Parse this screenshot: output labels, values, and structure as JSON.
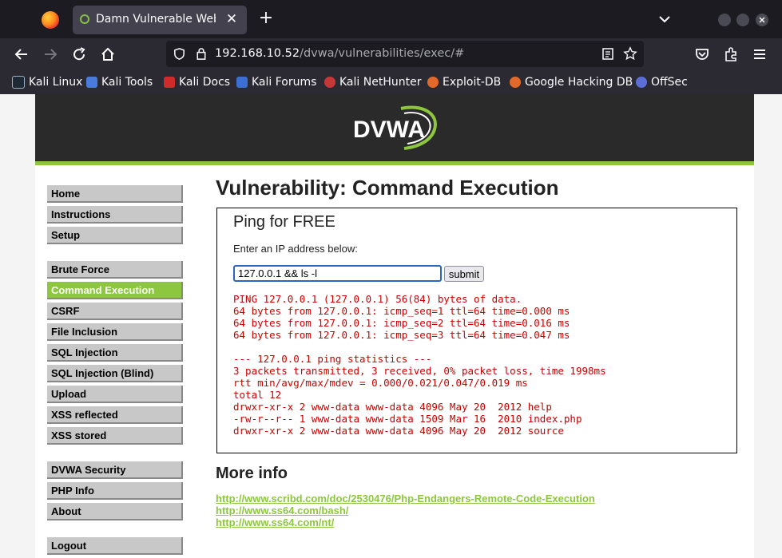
{
  "browser": {
    "tab_title": "Damn Vulnerable Web Ap",
    "url_host": "192.168.10.52",
    "url_path": "/dvwa/vulnerabilities/exec/#",
    "bookmarks": [
      {
        "label": "Kali Linux",
        "icon": "kali-icon"
      },
      {
        "label": "Kali Tools",
        "icon": "kali-tools-icon"
      },
      {
        "label": "Kali Docs",
        "icon": "kali-docs-icon"
      },
      {
        "label": "Kali Forums",
        "icon": "kali-forums-icon"
      },
      {
        "label": "Kali NetHunter",
        "icon": "nethunter-icon"
      },
      {
        "label": "Exploit-DB",
        "icon": "exploit-db-icon"
      },
      {
        "label": "Google Hacking DB",
        "icon": "ghdb-icon"
      },
      {
        "label": "OffSec",
        "icon": "offsec-icon"
      }
    ]
  },
  "header": {
    "logo_text": "DVWA"
  },
  "menu": {
    "items": [
      {
        "label": "Home"
      },
      {
        "label": "Instructions"
      },
      {
        "label": "Setup"
      },
      {
        "label": "Brute Force"
      },
      {
        "label": "Command Execution",
        "active": true
      },
      {
        "label": "CSRF"
      },
      {
        "label": "File Inclusion"
      },
      {
        "label": "SQL Injection"
      },
      {
        "label": "SQL Injection (Blind)"
      },
      {
        "label": "Upload"
      },
      {
        "label": "XSS reflected"
      },
      {
        "label": "XSS stored"
      },
      {
        "label": "DVWA Security"
      },
      {
        "label": "PHP Info"
      },
      {
        "label": "About"
      },
      {
        "label": "Logout"
      }
    ]
  },
  "main": {
    "title": "Vulnerability: Command Execution",
    "box_title": "Ping for FREE",
    "prompt": "Enter an IP address below:",
    "ip_value": "127.0.0.1 && ls -l",
    "submit_label": "submit",
    "output": "PING 127.0.0.1 (127.0.0.1) 56(84) bytes of data.\n64 bytes from 127.0.0.1: icmp_seq=1 ttl=64 time=0.000 ms\n64 bytes from 127.0.0.1: icmp_seq=2 ttl=64 time=0.016 ms\n64 bytes from 127.0.0.1: icmp_seq=3 ttl=64 time=0.047 ms\n\n--- 127.0.0.1 ping statistics ---\n3 packets transmitted, 3 received, 0% packet loss, time 1998ms\nrtt min/avg/max/mdev = 0.000/0.021/0.047/0.019 ms\ntotal 12\ndrwxr-xr-x 2 www-data www-data 4096 May 20  2012 help\n-rw-r--r-- 1 www-data www-data 1509 Mar 16  2010 index.php\ndrwxr-xr-x 2 www-data www-data 4096 May 20  2012 source",
    "more_info_title": "More info",
    "links": [
      "http://www.scribd.com/doc/2530476/Php-Endangers-Remote-Code-Execution",
      "http://www.ss64.com/bash/",
      "http://www.ss64.com/nt/"
    ]
  },
  "colors": {
    "accent": "#8dc63f",
    "output_red": "#cc0000",
    "header_dark": "#2a2a2a"
  }
}
